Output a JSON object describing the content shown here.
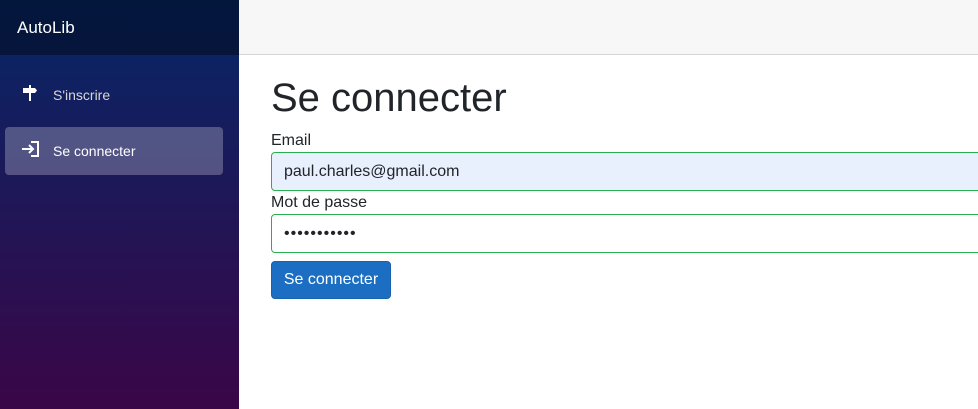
{
  "brand": "AutoLib",
  "nav": {
    "items": [
      {
        "label": "S'inscrire",
        "icon": "signpost-icon",
        "active": false
      },
      {
        "label": "Se connecter",
        "icon": "login-icon",
        "active": true
      }
    ]
  },
  "main": {
    "title": "Se connecter",
    "email_label": "Email",
    "email_value": "paul.charles@gmail.com",
    "password_label": "Mot de passe",
    "password_value": "•••••••••••",
    "submit_label": "Se connecter"
  },
  "colors": {
    "primary_button": "#1b6ec2",
    "valid_border": "#26b050",
    "sidebar_top": "#052767",
    "sidebar_bottom": "#3a0647"
  }
}
